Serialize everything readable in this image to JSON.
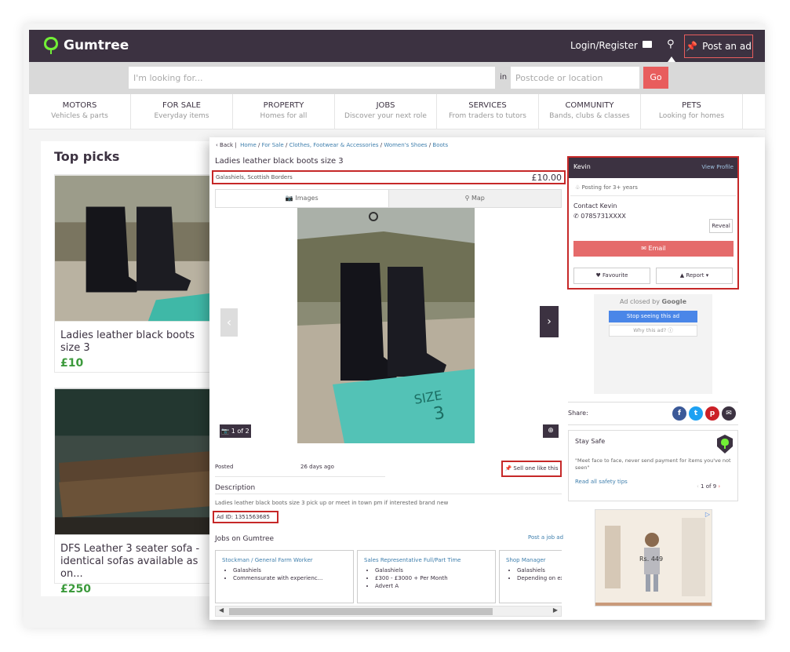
{
  "header": {
    "brand": "Gumtree",
    "login": "Login/Register",
    "post_ad": "Post an ad"
  },
  "search": {
    "placeholder": "I'm looking for...",
    "in_label": "in",
    "location_placeholder": "Postcode or location",
    "go": "Go"
  },
  "nav": [
    {
      "title": "MOTORS",
      "sub": "Vehicles & parts"
    },
    {
      "title": "FOR SALE",
      "sub": "Everyday items"
    },
    {
      "title": "PROPERTY",
      "sub": "Homes for all"
    },
    {
      "title": "JOBS",
      "sub": "Discover your next role"
    },
    {
      "title": "SERVICES",
      "sub": "From traders to tutors"
    },
    {
      "title": "COMMUNITY",
      "sub": "Bands, clubs & classes"
    },
    {
      "title": "PETS",
      "sub": "Looking for homes"
    }
  ],
  "top_picks": {
    "heading": "Top picks",
    "items": [
      {
        "title": "Ladies leather black boots size 3",
        "price": "£10"
      },
      {
        "title": "DFS Leather 3 seater sofa - identical sofas available as on...",
        "price": "£250"
      }
    ]
  },
  "listing": {
    "back": "‹ Back",
    "sep": "|",
    "breadcrumb": [
      "Home",
      "For Sale",
      "Clothes, Footwear & Accessories",
      "Women's Shoes",
      "Boots"
    ],
    "title": "Ladies leather black boots size 3",
    "location": "Galashiels, Scottish Borders",
    "price": "£10.00",
    "tab_images": "Images",
    "tab_map": "Map",
    "image_count": "1 of 2",
    "posted_label": "Posted",
    "posted_value": "26 days ago",
    "sell_one": "Sell one like this",
    "description_heading": "Description",
    "description": "Ladies leather black boots size 3 pick up or meet in town pm if interested brand new",
    "ad_id": "Ad ID: 1351563685",
    "jobs_heading": "Jobs on Gumtree",
    "post_job": "Post a job ad",
    "jobs": [
      {
        "title": "Stockman / General Farm Worker",
        "lines": [
          "Galashiels",
          "Commensurate with experienc..."
        ]
      },
      {
        "title": "Sales Representative Full/Part Time",
        "lines": [
          "Galashiels",
          "£300 - £3000 + Per Month",
          "Advert A"
        ]
      },
      {
        "title": "Shop Manager",
        "lines": [
          "Galashiels",
          "Depending on exp"
        ]
      }
    ]
  },
  "seller": {
    "name": "Kevin",
    "view_profile": "View Profile",
    "since": "Posting for 3+ years",
    "contact_label": "Contact Kevin",
    "phone": "0785731XXXX",
    "reveal": "Reveal",
    "email": "Email",
    "favourite": "Favourite",
    "report": "Report"
  },
  "ad_closed": {
    "text": "Ad closed by",
    "brand": "Google",
    "stop": "Stop seeing this ad",
    "why": "Why this ad? ⓘ"
  },
  "share_label": "Share:",
  "safety": {
    "heading": "Stay Safe",
    "quote": "\"Meet face to face, never send payment for items you've not seen\"",
    "link": "Read all safety tips",
    "pager": "1 of 9"
  },
  "banner_price": "Rs. 449",
  "colors": {
    "brand_dark": "#3c3241",
    "accent_red": "#e85d5d",
    "highlight_box": "#c62828",
    "price_green": "#3c9a3c",
    "link_blue": "#3f7fad"
  }
}
